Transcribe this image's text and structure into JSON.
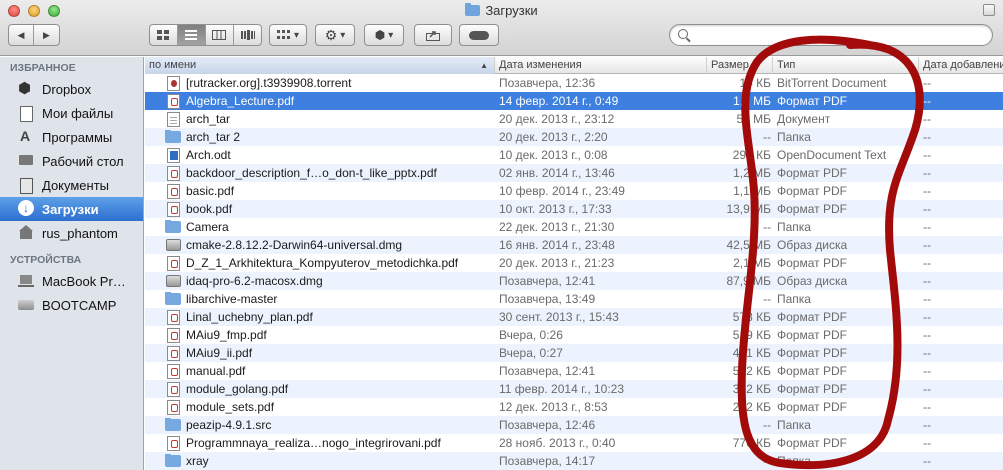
{
  "window": {
    "title": "Загрузки"
  },
  "toolbar": {
    "back_label": "◀",
    "forward_label": "▶",
    "view_icons": [
      "icon-view-icon",
      "list-view-icon",
      "column-view-icon",
      "coverflow-view-icon"
    ],
    "arrange_label": "▾",
    "action_label": "▾",
    "dropbox_label": "▾",
    "search_placeholder": ""
  },
  "sidebar": {
    "favorites_header": "ИЗБРАННОЕ",
    "favorites": [
      {
        "label": "Dropbox",
        "icon": "dropbox-icon"
      },
      {
        "label": "Мои файлы",
        "icon": "files-icon"
      },
      {
        "label": "Программы",
        "icon": "apps-icon"
      },
      {
        "label": "Рабочий стол",
        "icon": "desktop-icon"
      },
      {
        "label": "Документы",
        "icon": "documents-icon"
      },
      {
        "label": "Загрузки",
        "icon": "downloads-icon"
      },
      {
        "label": "rus_phantom",
        "icon": "home-icon"
      }
    ],
    "devices_header": "УСТРОЙСТВА",
    "devices": [
      {
        "label": "MacBook Pr…",
        "icon": "laptop-icon"
      },
      {
        "label": "BOOTCAMP",
        "icon": "disk-icon"
      }
    ]
  },
  "columns": {
    "name": "по имени",
    "date": "Дата изменения",
    "size": "Размер",
    "type": "Тип",
    "added": "Дата добавления"
  },
  "files": [
    {
      "icon": "torrent",
      "name": "[rutracker.org].t3939908.torrent",
      "date": "Позавчера, 12:36",
      "size": "14 КБ",
      "type": "BitTorrent Document",
      "added": "--"
    },
    {
      "icon": "pdf",
      "name": "Algebra_Lecture.pdf",
      "date": "14 февр. 2014 г., 0:49",
      "size": "1,1 МБ",
      "type": "Формат PDF",
      "added": "--"
    },
    {
      "icon": "doc",
      "name": "arch_tar",
      "date": "20 дек. 2013 г., 23:12",
      "size": "55 МБ",
      "type": "Документ",
      "added": "--"
    },
    {
      "icon": "folder",
      "name": "arch_tar 2",
      "date": "20 дек. 2013 г., 2:20",
      "size": "--",
      "type": "Папка",
      "added": "--"
    },
    {
      "icon": "odt",
      "name": "Arch.odt",
      "date": "10 дек. 2013 г., 0:08",
      "size": "299 КБ",
      "type": "OpenDocument Text",
      "added": "--"
    },
    {
      "icon": "pdf",
      "name": "backdoor_description_f…o_don-t_like_pptx.pdf",
      "date": "02 янв. 2014 г., 13:46",
      "size": "1,2 МБ",
      "type": "Формат PDF",
      "added": "--"
    },
    {
      "icon": "pdf",
      "name": "basic.pdf",
      "date": "10 февр. 2014 г., 23:49",
      "size": "1,1 МБ",
      "type": "Формат PDF",
      "added": "--"
    },
    {
      "icon": "pdf",
      "name": "book.pdf",
      "date": "10 окт. 2013 г., 17:33",
      "size": "13,9 МБ",
      "type": "Формат PDF",
      "added": "--"
    },
    {
      "icon": "folder",
      "name": "Camera",
      "date": "22 дек. 2013 г., 21:30",
      "size": "--",
      "type": "Папка",
      "added": "--"
    },
    {
      "icon": "disk",
      "name": "cmake-2.8.12.2-Darwin64-universal.dmg",
      "date": "16 янв. 2014 г., 23:48",
      "size": "42,5 МБ",
      "type": "Образ диска",
      "added": "--"
    },
    {
      "icon": "pdf",
      "name": "D_Z_1_Arkhitektura_Kompyuterov_metodichka.pdf",
      "date": "20 дек. 2013 г., 21:23",
      "size": "2,1 МБ",
      "type": "Формат PDF",
      "added": "--"
    },
    {
      "icon": "disk",
      "name": "idaq-pro-6.2-macosx.dmg",
      "date": "Позавчера, 12:41",
      "size": "87,9 МБ",
      "type": "Образ диска",
      "added": "--"
    },
    {
      "icon": "folder",
      "name": "libarchive-master",
      "date": "Позавчера, 13:49",
      "size": "--",
      "type": "Папка",
      "added": "--"
    },
    {
      "icon": "pdf",
      "name": "Linal_uchebny_plan.pdf",
      "date": "30 сент. 2013 г., 15:43",
      "size": "573 КБ",
      "type": "Формат PDF",
      "added": "--"
    },
    {
      "icon": "pdf",
      "name": "MAiu9_fmp.pdf",
      "date": "Вчера, 0:26",
      "size": "519 КБ",
      "type": "Формат PDF",
      "added": "--"
    },
    {
      "icon": "pdf",
      "name": "MAiu9_ii.pdf",
      "date": "Вчера, 0:27",
      "size": "461 КБ",
      "type": "Формат PDF",
      "added": "--"
    },
    {
      "icon": "pdf",
      "name": "manual.pdf",
      "date": "Позавчера, 12:41",
      "size": "542 КБ",
      "type": "Формат PDF",
      "added": "--"
    },
    {
      "icon": "pdf",
      "name": "module_golang.pdf",
      "date": "11 февр. 2014 г., 10:23",
      "size": "362 КБ",
      "type": "Формат PDF",
      "added": "--"
    },
    {
      "icon": "pdf",
      "name": "module_sets.pdf",
      "date": "12 дек. 2013 г., 8:53",
      "size": "272 КБ",
      "type": "Формат PDF",
      "added": "--"
    },
    {
      "icon": "folder",
      "name": "peazip-4.9.1.src",
      "date": "Позавчера, 12:46",
      "size": "--",
      "type": "Папка",
      "added": "--"
    },
    {
      "icon": "pdf",
      "name": "Programmnaya_realiza…nogo_integrirovani.pdf",
      "date": "28 нояб. 2013 г., 0:40",
      "size": "776 КБ",
      "type": "Формат PDF",
      "added": "--"
    },
    {
      "icon": "folder",
      "name": "xray",
      "date": "Позавчера, 14:17",
      "size": "--",
      "type": "Папка",
      "added": "--"
    }
  ],
  "selected_index": 1,
  "colors": {
    "selection": "#3d80df",
    "annotation": "#a30b0b",
    "sidebar_bg": "#dfe4ea"
  }
}
